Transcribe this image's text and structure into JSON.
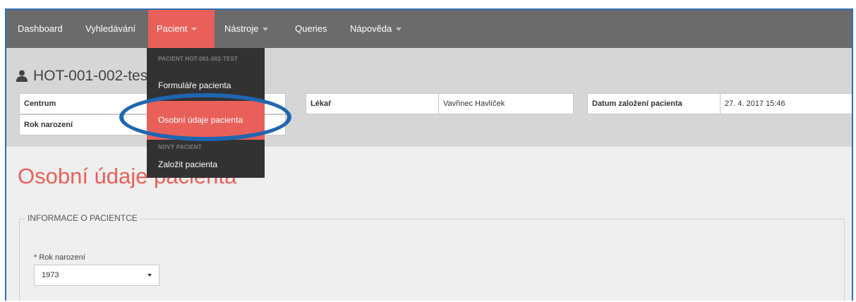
{
  "nav": {
    "items": [
      {
        "label": "Dashboard"
      },
      {
        "label": "Vyhledávání"
      },
      {
        "label": "Pacient"
      },
      {
        "label": "Nástroje"
      },
      {
        "label": "Queries"
      },
      {
        "label": "Nápověda"
      }
    ]
  },
  "patient": {
    "title": "HOT-001-002-test"
  },
  "info": {
    "centrum_label": "Centrum",
    "rok_label": "Rok narození",
    "lekar_label": "Lékař",
    "lekar_value": "Vavřinec Havlíček",
    "datum_label": "Datum založení pacienta",
    "datum_value": "27. 4. 2017 15:46"
  },
  "dropdown": {
    "header1": "PACIENT HOT-001-002-TEST",
    "item1": "Formuláře pacienta",
    "item2": "Osobní údaje pacienta",
    "header2": "NOVÝ PACIENT",
    "item3": "Založit pacienta"
  },
  "page": {
    "heading": "Osobní údaje pacienta"
  },
  "form": {
    "legend": "INFORMACE O PACIENTCE",
    "rok_label": "* Rok narození",
    "rok_value": "1973"
  },
  "colors": {
    "accent": "#e9605a",
    "nav_bg": "#6b6b6b",
    "dropdown_bg": "#323232",
    "annotation": "#1f66b0"
  }
}
